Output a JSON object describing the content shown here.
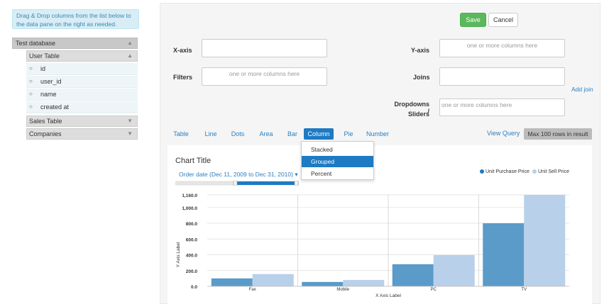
{
  "sidebar": {
    "hint": "Drag & Drop columns from the list below to the data pane on the right as needed.",
    "database": "Test database",
    "tables": [
      {
        "name": "User Table",
        "expanded": true,
        "columns": [
          "id",
          "user_id",
          "name",
          "created at"
        ]
      },
      {
        "name": "Sales Table",
        "expanded": false
      },
      {
        "name": "Companies",
        "expanded": false
      }
    ]
  },
  "toolbar": {
    "save_label": "Save",
    "cancel_label": "Cancel"
  },
  "fields": {
    "xaxis_label": "X-axis",
    "yaxis_label": "Y-axis",
    "yaxis_placeholder": "one or more columns here",
    "filters_label": "Filters",
    "filters_placeholder": "one or more columns here",
    "joins_label": "Joins",
    "add_join": "Add join",
    "dropdowns_label_1": "Dropdowns /",
    "dropdowns_label_2": "Sliders",
    "dropdowns_placeholder": "one or more columns here"
  },
  "chart_tabs": [
    "Table",
    "Line",
    "Dots",
    "Area",
    "Bar",
    "Column",
    "Pie",
    "Number"
  ],
  "active_tab": "Column",
  "view_query": "View Query",
  "max_rows": "Max 100 rows in result",
  "column_mode_menu": [
    "Stacked",
    "Grouped",
    "Percent"
  ],
  "selected_mode": "Grouped",
  "chart_card": {
    "title": "Chart Title",
    "date_filter": "Order date (Dec 11, 2009 to Dec 31, 2010) ▾"
  },
  "colors": {
    "accent": "#1d7ac3",
    "save_green": "#5cb85c",
    "series_dark": "#5a9bc9",
    "series_light": "#b9d0ea"
  },
  "chart_data": {
    "type": "bar",
    "categories": [
      "Fax",
      "Mobile",
      "PC",
      "TV"
    ],
    "series": [
      {
        "name": "Unit Purchase Price",
        "values": [
          100,
          55,
          280,
          800
        ]
      },
      {
        "name": "Unit Sell Price",
        "values": [
          155,
          80,
          395,
          1160
        ]
      }
    ],
    "xlabel": "X Axis Label",
    "ylabel": "Y Axis Label",
    "ylim": [
      0,
      1160
    ],
    "yticks": [
      "0.0",
      "200.0",
      "400.0",
      "600.0",
      "800.0",
      "1,000.0",
      "1,160.0"
    ],
    "legend": "top-right",
    "grid": true
  }
}
